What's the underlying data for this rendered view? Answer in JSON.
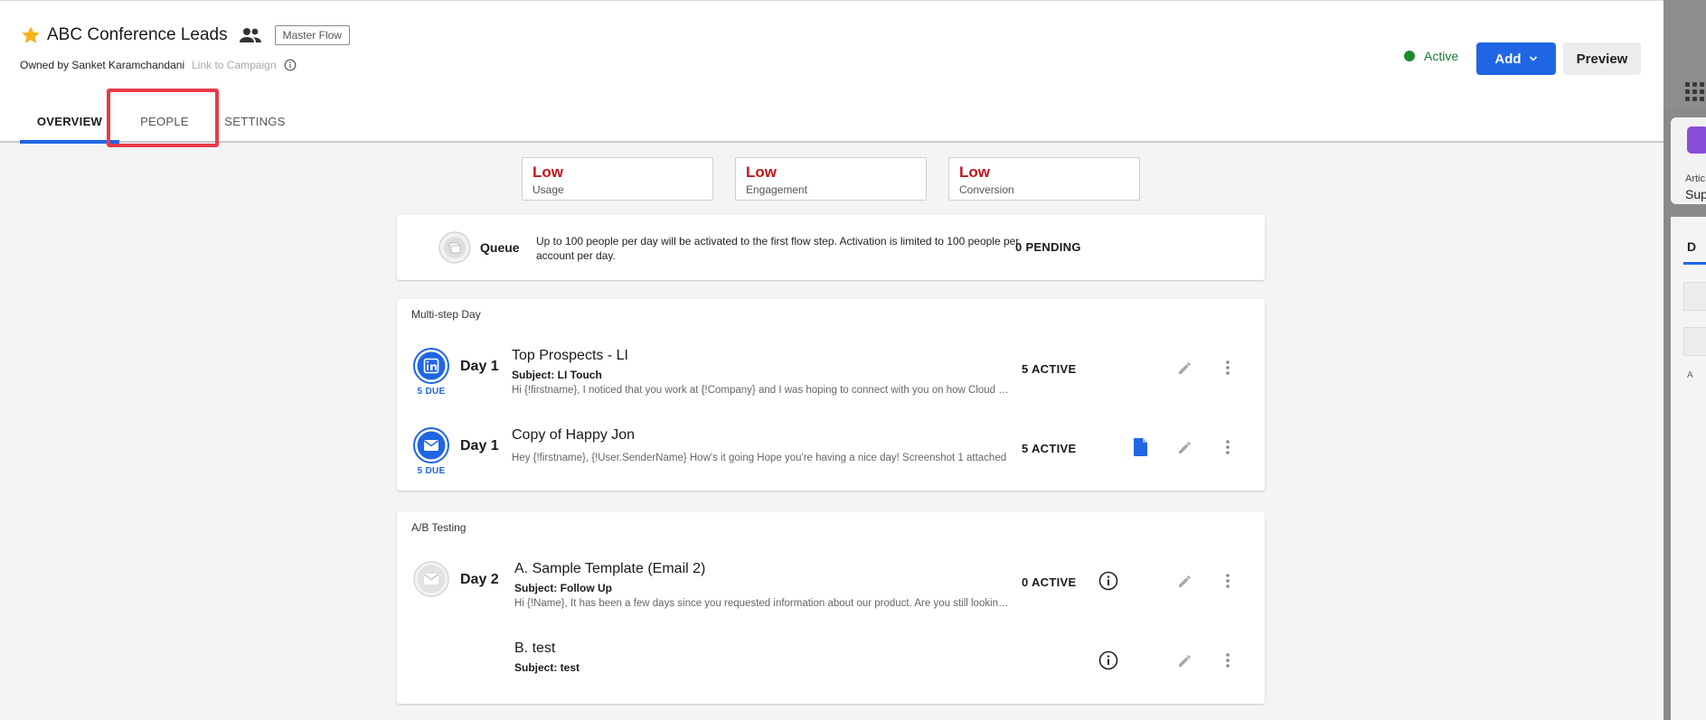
{
  "header": {
    "title": "ABC Conference Leads",
    "badge": "Master Flow",
    "owner": "Owned by Sanket Karamchandani",
    "link_campaign": "Link to Campaign",
    "status": "Active",
    "add_label": "Add",
    "preview_label": "Preview"
  },
  "tabs": [
    {
      "label": "OVERVIEW"
    },
    {
      "label": "PEOPLE"
    },
    {
      "label": "SETTINGS"
    }
  ],
  "metrics": [
    {
      "level": "Low",
      "label": "Usage"
    },
    {
      "level": "Low",
      "label": "Engagement"
    },
    {
      "level": "Low",
      "label": "Conversion"
    }
  ],
  "queue": {
    "title": "Queue",
    "description": "Up to 100 people per day will be activated to the first flow step. Activation is limited to 100 people per account per day.",
    "pending": "0 PENDING"
  },
  "sections": [
    {
      "label": "Multi-step Day",
      "steps": [
        {
          "icon": "linkedin-icon",
          "due": "5 DUE",
          "day": "Day 1",
          "title": "Top Prospects - LI",
          "subject": "Subject: LI Touch",
          "preview": "Hi {!firstname}, I noticed that you work at {!Company} and I was hoping to connect with you on how Cloud Computing solutions",
          "active": "5 ACTIVE"
        },
        {
          "icon": "email-icon",
          "due": "5 DUE",
          "day": "Day 1",
          "title": "Copy of Happy Jon",
          "preview": "Hey {!firstname},   {!User.SenderName} How's it going   Hope you're having a nice day! Screenshot 1 attached",
          "active": "5 ACTIVE"
        }
      ]
    },
    {
      "label": "A/B Testing",
      "steps": [
        {
          "icon": "email-disabled-icon",
          "day": "Day 2",
          "title": "A. Sample Template (Email 2)",
          "subject": "Subject: Follow Up",
          "preview": "Hi {!Name}, It has been a few days since you requested information about our product. Are you still looking for a solution",
          "active": "0 ACTIVE"
        },
        {
          "title": "B. test",
          "subject": "Subject: test"
        }
      ]
    }
  ],
  "right_panel": {
    "text1": "Artic",
    "text2": "Sup",
    "tab": "D",
    "small": "A"
  },
  "colors": {
    "primary": "#1f66e5",
    "low": "#c0171c",
    "active": "#1b8a2e",
    "highlight": "#e8394a"
  }
}
